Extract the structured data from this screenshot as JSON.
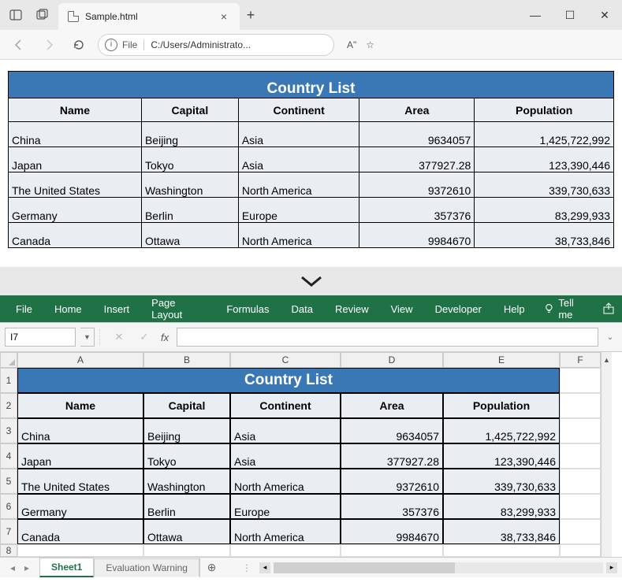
{
  "browser": {
    "tab_label": "Sample.html",
    "file_label": "File",
    "url_text": "C:/Users/Administrato...",
    "font_btn": "A\"",
    "star": "☆"
  },
  "table": {
    "title": "Country List",
    "headers": [
      "Name",
      "Capital",
      "Continent",
      "Area",
      "Population"
    ],
    "rows": [
      {
        "name": "China",
        "capital": "Beijing",
        "continent": "Asia",
        "area": "9634057",
        "population": "1,425,722,992"
      },
      {
        "name": "Japan",
        "capital": "Tokyo",
        "continent": "Asia",
        "area": "377927.28",
        "population": "123,390,446"
      },
      {
        "name": "The United States",
        "capital": "Washington",
        "continent": "North America",
        "area": "9372610",
        "population": "339,730,633"
      },
      {
        "name": "Germany",
        "capital": "Berlin",
        "continent": "Europe",
        "area": "357376",
        "population": "83,299,933"
      },
      {
        "name": "Canada",
        "capital": "Ottawa",
        "continent": "North America",
        "area": "9984670",
        "population": "38,733,846"
      }
    ]
  },
  "ribbon": {
    "tabs": [
      "File",
      "Home",
      "Insert",
      "Page Layout",
      "Formulas",
      "Data",
      "Review",
      "View",
      "Developer",
      "Help"
    ],
    "tellme": "Tell me"
  },
  "excel": {
    "namebox": "I7",
    "fx": "fx",
    "cols": [
      "A",
      "B",
      "C",
      "D",
      "E",
      "F"
    ],
    "rows": [
      "1",
      "2",
      "3",
      "4",
      "5",
      "6",
      "7",
      "8"
    ],
    "sheet_active": "Sheet1",
    "sheet_other": "Evaluation Warning"
  }
}
